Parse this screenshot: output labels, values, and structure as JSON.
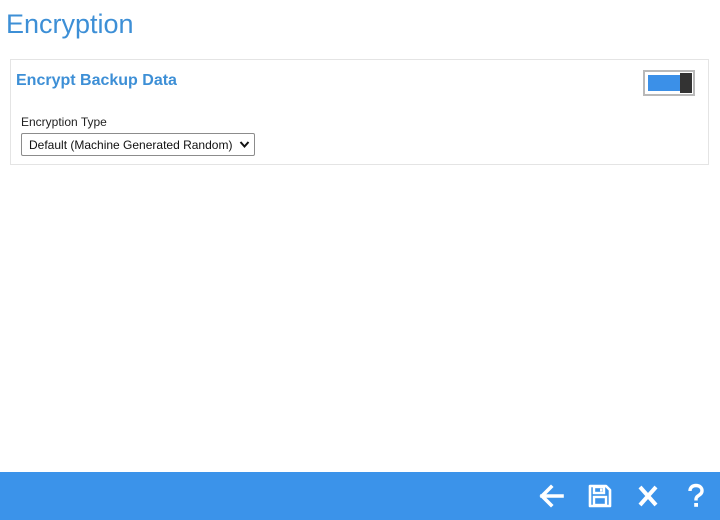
{
  "page": {
    "title": "Encryption"
  },
  "panel": {
    "title": "Encrypt Backup Data",
    "toggle_on": true,
    "encryption_type_label": "Encryption Type",
    "encryption_type_value": "Default (Machine Generated Random)"
  },
  "footer": {
    "buttons": [
      {
        "icon": "arrow-left-icon",
        "action": "back"
      },
      {
        "icon": "save-icon",
        "action": "save"
      },
      {
        "icon": "close-icon",
        "action": "close"
      },
      {
        "icon": "help-icon",
        "action": "help"
      }
    ]
  },
  "colors": {
    "accent": "#3b90e8",
    "title": "#3d8fd6",
    "footer": "#3b93ea"
  }
}
